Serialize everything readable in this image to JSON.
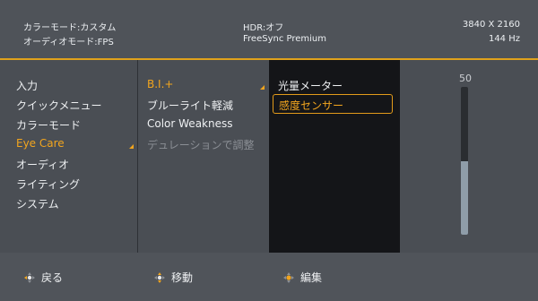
{
  "header": {
    "color_mode": "カラーモード:カスタム",
    "audio_mode": "オーディオモード:FPS",
    "hdr": "HDR:オフ",
    "freesync": "FreeSync Premium",
    "resolution": "3840 X 2160",
    "refresh": "144 Hz"
  },
  "menu_main": [
    "入力",
    "クイックメニュー",
    "カラーモード",
    "Eye Care",
    "オーディオ",
    "ライティング",
    "システム"
  ],
  "menu_eyecare": [
    "B.I.+",
    "ブルーライト軽減",
    "Color Weakness",
    "デュレーションで調整"
  ],
  "menu_bi": [
    "光量メーター",
    "感度センサー"
  ],
  "slider": {
    "value": "50",
    "fill_fraction": 0.5
  },
  "footer": {
    "back": "戻る",
    "move": "移動",
    "edit": "編集"
  },
  "colors": {
    "accent": "#f2a51e",
    "panel": "#4a4e54",
    "dark_panel": "#141518"
  },
  "icons": {
    "back": "dpad-left-icon",
    "move": "dpad-updown-icon",
    "edit": "dpad-center-icon"
  }
}
